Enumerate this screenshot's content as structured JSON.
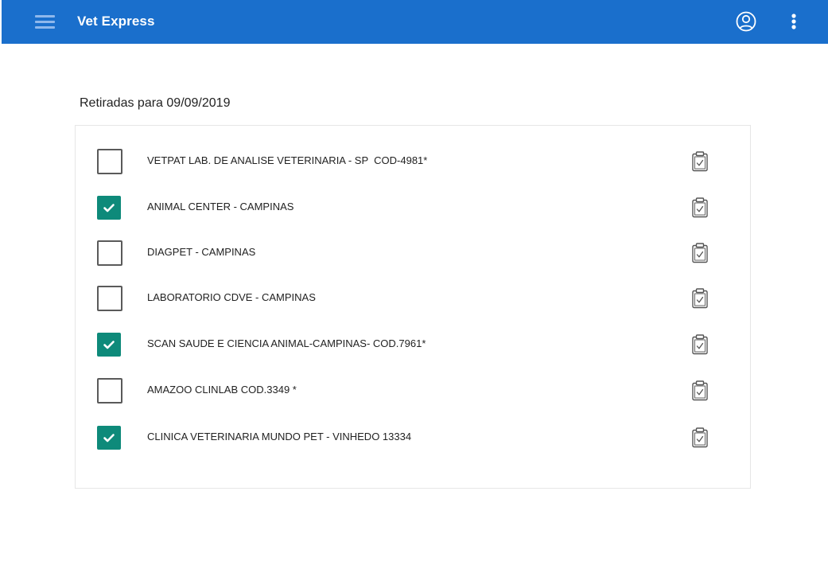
{
  "appbar": {
    "title": "Vet Express",
    "icons": [
      "menu-icon",
      "account-circle-icon",
      "more-vert-icon"
    ],
    "color": "#1a6fcc"
  },
  "main": {
    "section_title": "Retiradas para 09/09/2019",
    "accent_color": "#0e8a7a",
    "items": [
      {
        "label": "VETPAT LAB. DE ANALISE VETERINARIA - SP  COD-4981*",
        "checked": false,
        "action_icon": "clipboard-check-icon"
      },
      {
        "label": "ANIMAL CENTER - CAMPINAS",
        "checked": true,
        "action_icon": "clipboard-check-icon"
      },
      {
        "label": "DIAGPET - CAMPINAS",
        "checked": false,
        "action_icon": "clipboard-check-icon"
      },
      {
        "label": "LABORATORIO CDVE - CAMPINAS",
        "checked": false,
        "action_icon": "clipboard-check-icon"
      },
      {
        "label": "SCAN SAUDE E CIENCIA ANIMAL-CAMPINAS- COD.7961*",
        "checked": true,
        "action_icon": "clipboard-check-icon"
      },
      {
        "label": "AMAZOO CLINLAB COD.3349 *",
        "checked": false,
        "action_icon": "clipboard-check-icon"
      },
      {
        "label": "CLINICA VETERINARIA MUNDO PET - VINHEDO 13334",
        "checked": true,
        "action_icon": "clipboard-check-icon"
      }
    ]
  }
}
